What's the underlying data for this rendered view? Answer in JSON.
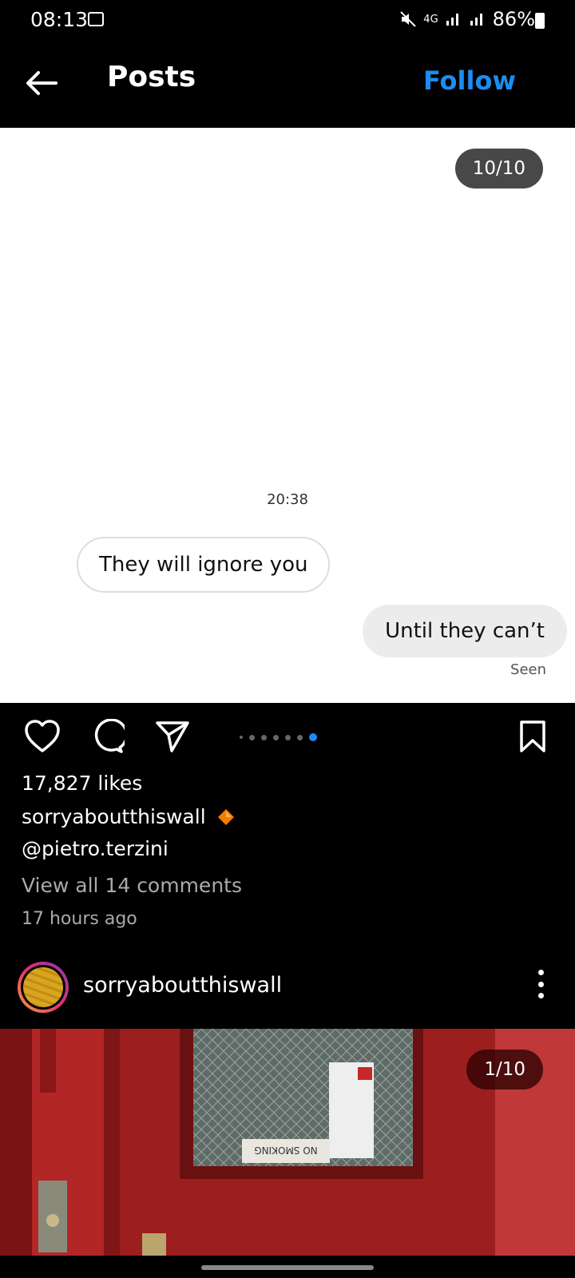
{
  "status_bar": {
    "time": "08:13",
    "network": "4G",
    "battery": "86%"
  },
  "header": {
    "title": "Posts",
    "follow_label": "Follow"
  },
  "post1": {
    "counter": "10/10",
    "chat": {
      "timestamp": "20:38",
      "incoming": "They will ignore you",
      "outgoing": "Until they can’t",
      "seen": "Seen"
    },
    "likes": "17,827 likes",
    "author": "sorryaboutthiswall",
    "mention": "@pietro.terzini",
    "comments_link": "View all 14 comments",
    "time_ago": "17 hours ago"
  },
  "post2": {
    "author": "sorryaboutthiswall",
    "counter": "1/10",
    "sign_text": "NO SMOKING"
  },
  "colors": {
    "accent": "#1d8cf0",
    "verified": "#f57c00"
  }
}
